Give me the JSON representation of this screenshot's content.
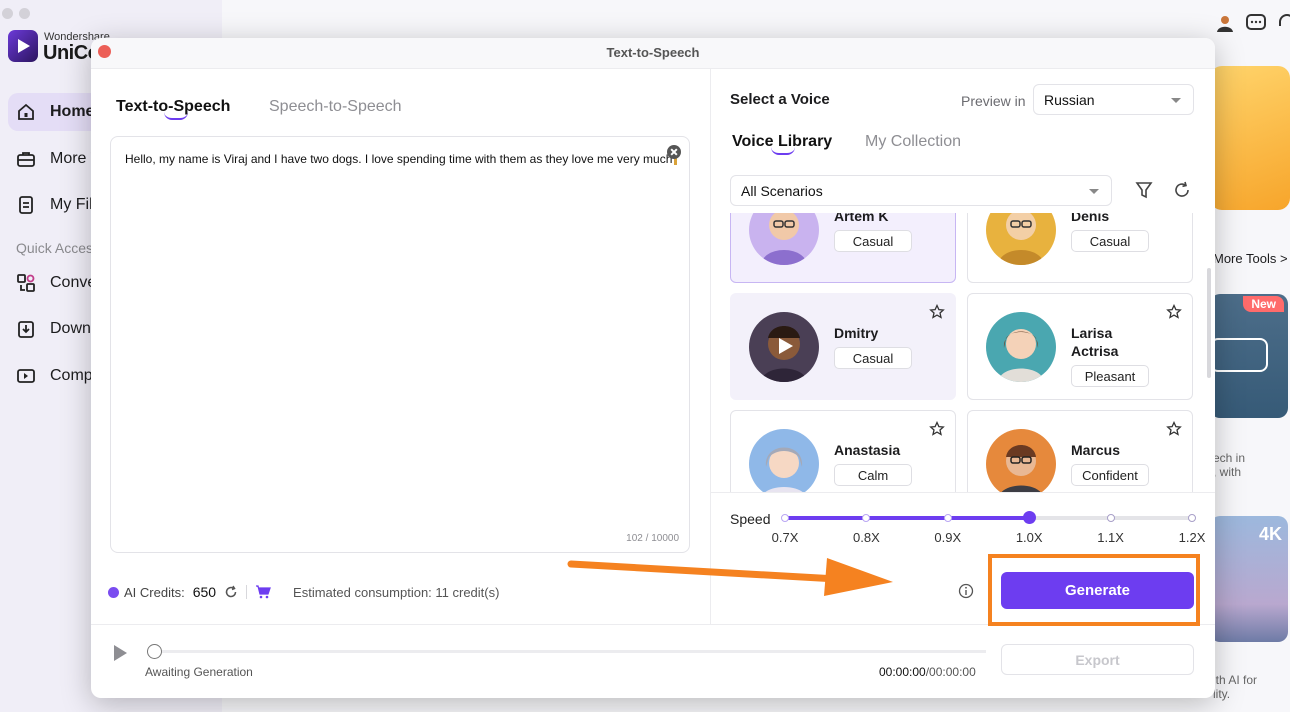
{
  "background_app": {
    "logo_top": "Wondershare",
    "logo_main": "UniCo",
    "nav": [
      {
        "label": "Home"
      },
      {
        "label": "More T"
      },
      {
        "label": "My Fil"
      }
    ],
    "quick_access_label": "Quick Acces",
    "quick_items": [
      {
        "label": "Conve"
      },
      {
        "label": "Downl"
      },
      {
        "label": "Comp"
      }
    ],
    "more_tools": "More Tools >",
    "new_badge": "New",
    "side_text_1": "ech in\n, with",
    "card_4k": "4K",
    "side_text_2": "ith AI for\nlity."
  },
  "dialog": {
    "title": "Text-to-Speech",
    "tabs": [
      {
        "label": "Text-to-Speech",
        "active": true
      },
      {
        "label": "Speech-to-Speech",
        "active": false
      }
    ],
    "editor": {
      "text": "Hello, my name is Viraj and I have two dogs. I love spending time with them as they love me very much",
      "char_count": "102 / 10000"
    },
    "credits": {
      "label": "AI Credits:",
      "value": "650",
      "estimated": "Estimated consumption: 11 credit(s)"
    },
    "voice_panel": {
      "title": "Select a Voice",
      "preview_label": "Preview in",
      "preview_language": "Russian",
      "tabs": [
        {
          "label": "Voice Library",
          "active": true
        },
        {
          "label": "My Collection",
          "active": false
        }
      ],
      "scenario": "All Scenarios",
      "voices": [
        {
          "name": "Artem K",
          "tag": "Casual",
          "state": "selected",
          "avatar_bg": "#c9b3ef"
        },
        {
          "name": "Denis",
          "tag": "Casual",
          "state": "normal",
          "avatar_bg": "#e8b23e"
        },
        {
          "name": "Dmitry",
          "tag": "Casual",
          "state": "hover",
          "avatar_bg": "#4a3f55"
        },
        {
          "name": "Larisa Actrisa",
          "tag": "Pleasant",
          "state": "normal",
          "avatar_bg": "#4aa7b0"
        },
        {
          "name": "Anastasia",
          "tag": "Calm",
          "state": "normal",
          "avatar_bg": "#8fb8e8"
        },
        {
          "name": "Marcus",
          "tag": "Confident",
          "state": "normal",
          "avatar_bg": "#e6893c"
        }
      ]
    },
    "speed": {
      "label": "Speed",
      "options": [
        "0.7X",
        "0.8X",
        "0.9X",
        "1.0X",
        "1.1X",
        "1.2X"
      ],
      "selected": "1.0X"
    },
    "generate_label": "Generate",
    "player": {
      "status": "Awaiting Generation",
      "elapsed": "00:00:00",
      "total": "/00:00:00"
    },
    "export_label": "Export"
  },
  "colors": {
    "accent": "#6d3df0",
    "highlight": "#f58220",
    "close": "#ec5f57"
  }
}
